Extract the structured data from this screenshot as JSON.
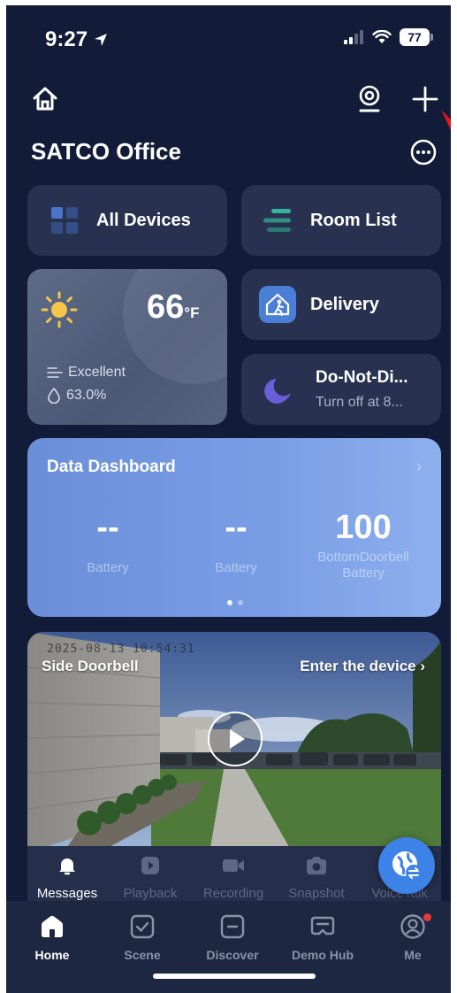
{
  "status_bar": {
    "time": "9:27",
    "battery": "77"
  },
  "header": {
    "title": "SATCO Office"
  },
  "cards": {
    "all_devices": "All Devices",
    "room_list": "Room List",
    "delivery": "Delivery",
    "dnd_title": "Do-Not-Di...",
    "dnd_subtitle": "Turn off at 8..."
  },
  "weather": {
    "temperature": "66",
    "unit": "°F",
    "air_quality": "Excellent",
    "humidity": "63.0%"
  },
  "dashboard": {
    "title": "Data Dashboard",
    "chevron": "›",
    "metrics": [
      {
        "value": "--",
        "label": "Battery"
      },
      {
        "value": "--",
        "label": "Battery"
      },
      {
        "value": "100",
        "label": "BottomDoorbell Battery"
      }
    ]
  },
  "feed": {
    "device_name": "Side Doorbell",
    "enter_label": "Enter the device  ›",
    "timestamp": "2025-08-13 10:54:31"
  },
  "actions": [
    {
      "label": "Messages",
      "icon": "bell-icon",
      "active": true
    },
    {
      "label": "Playback",
      "icon": "playback-icon",
      "active": false
    },
    {
      "label": "Recording",
      "icon": "video-camera-icon",
      "active": false
    },
    {
      "label": "Snapshot",
      "icon": "camera-icon",
      "active": false
    },
    {
      "label": "VoiceTalk",
      "icon": "microphone-icon",
      "active": false
    }
  ],
  "tabs": [
    {
      "label": "Home",
      "icon": "home-icon",
      "active": true
    },
    {
      "label": "Scene",
      "icon": "checkbox-icon",
      "active": false
    },
    {
      "label": "Discover",
      "icon": "discover-icon",
      "active": false
    },
    {
      "label": "Demo Hub",
      "icon": "hub-icon",
      "active": false
    },
    {
      "label": "Me",
      "icon": "user-icon",
      "active": false
    }
  ],
  "colors": {
    "background": "#121b38",
    "card": "#283250",
    "accent_blue": "#3d82e6",
    "sun_yellow": "#f5c64a",
    "moon_purple": "#6a5fd8",
    "badge_red": "#e93a3a"
  }
}
